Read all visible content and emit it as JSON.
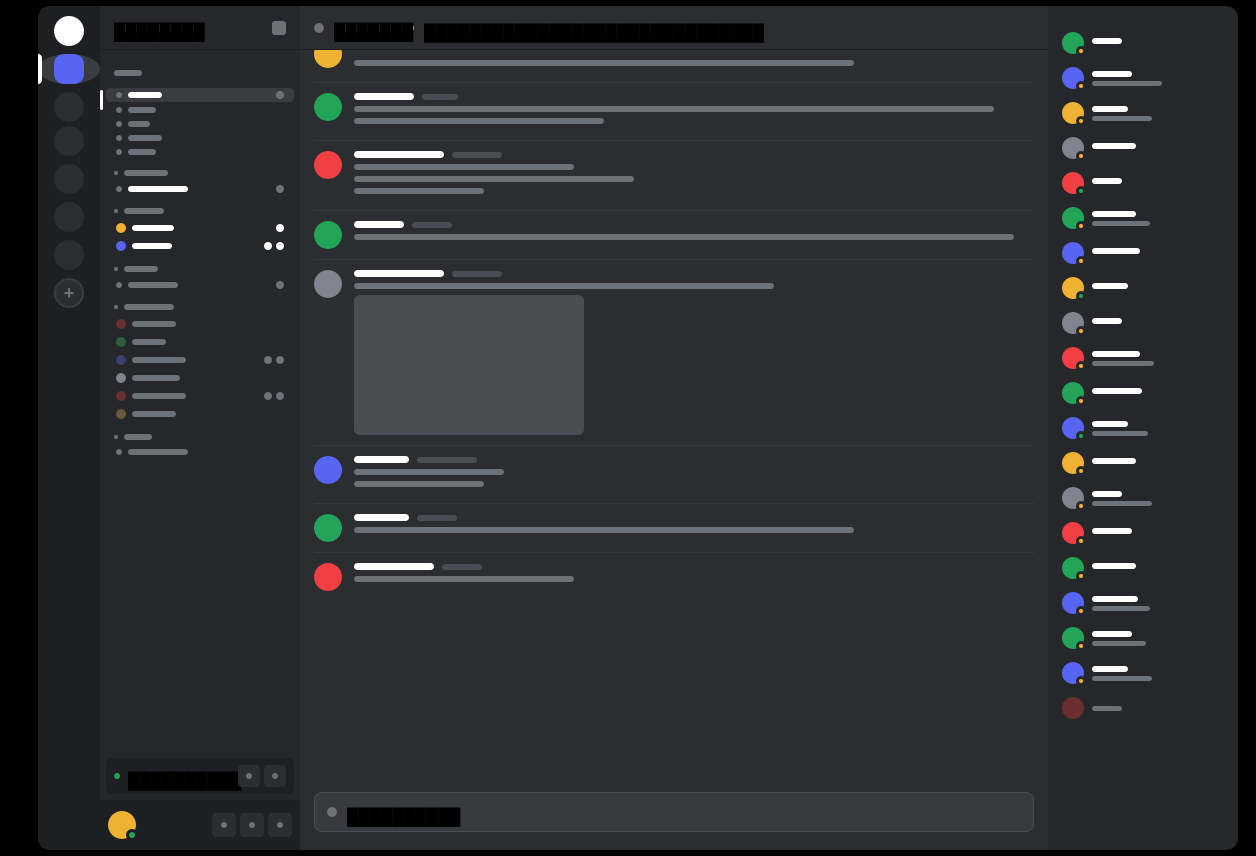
{
  "server_rail": {
    "home": {
      "color": "white"
    },
    "active_server": {
      "color": "blurple"
    },
    "cluster_count": 2,
    "extra_servers": 3,
    "add_label": "+"
  },
  "server_header": {
    "name": "████████",
    "dropdown_icon": "square"
  },
  "channel_categories": [
    {
      "label_w": 28,
      "items": []
    },
    {
      "label_w": 0,
      "items": [
        {
          "selected": true,
          "label_w": 34,
          "bright": true,
          "right_dot": "dim"
        },
        {
          "label_w": 28,
          "bright": false
        },
        {
          "label_w": 22,
          "bright": false
        },
        {
          "label_w": 34,
          "bright": false
        },
        {
          "label_w": 28,
          "bright": false
        }
      ]
    },
    {
      "label_w": 44,
      "dot": true,
      "items": [
        {
          "label_w": 60,
          "bright": true,
          "right_dot": "dim"
        }
      ]
    },
    {
      "label_w": 40,
      "dot": true,
      "items": [
        {
          "avatar": "yellow",
          "label_w": 42,
          "bright": true,
          "right": [
            "w"
          ]
        },
        {
          "avatar": "blurple",
          "label_w": 40,
          "bright": true,
          "right": [
            "w",
            "w"
          ]
        }
      ]
    },
    {
      "label_w": 34,
      "dot": true,
      "items": [
        {
          "label_w": 50,
          "bright": false,
          "right_dot": "dim"
        }
      ]
    },
    {
      "label_w": 50,
      "dot": true,
      "items": [
        {
          "avatar": "darkred",
          "label_w": 44,
          "bright": false
        },
        {
          "avatar": "darkgreen",
          "label_w": 34,
          "bright": false
        },
        {
          "avatar": "darkblue",
          "label_w": 54,
          "bright": false,
          "right": [
            "dim",
            "dim"
          ]
        },
        {
          "avatar": "gray",
          "label_w": 48,
          "bright": false
        },
        {
          "avatar": "darkred",
          "label_w": 54,
          "bright": false,
          "right": [
            "dim",
            "dim"
          ]
        },
        {
          "avatar": "darkbrown",
          "label_w": 44,
          "bright": false
        }
      ]
    },
    {
      "label_w": 28,
      "dot": true,
      "items": [
        {
          "label_w": 60,
          "bright": false
        }
      ]
    }
  ],
  "voice_panel": {
    "connected_label": "██████████"
  },
  "user_panel": {
    "avatar_color": "yellow",
    "status": "online"
  },
  "chat_header": {
    "icon": "hash",
    "title": "███████",
    "topic": "██████████████████████████████"
  },
  "messages": [
    {
      "avatar": "yellow",
      "half": true,
      "name_w": 0,
      "ts_w": 0,
      "lines": [
        500
      ]
    },
    {
      "avatar": "green",
      "name_w": 60,
      "ts_w": 36,
      "lines": [
        640,
        250
      ]
    },
    {
      "avatar": "red",
      "name_w": 90,
      "ts_w": 50,
      "lines": [
        220,
        280,
        130
      ]
    },
    {
      "avatar": "green",
      "name_w": 50,
      "ts_w": 40,
      "lines": [
        660
      ]
    },
    {
      "avatar": "gray",
      "name_w": 90,
      "ts_w": 50,
      "lines": [
        420
      ],
      "attachment": true
    },
    {
      "avatar": "blurple",
      "name_w": 55,
      "ts_w": 60,
      "lines": [
        150,
        130
      ]
    },
    {
      "avatar": "green",
      "name_w": 55,
      "ts_w": 40,
      "lines": [
        500
      ]
    },
    {
      "avatar": "red",
      "name_w": 80,
      "ts_w": 40,
      "lines": [
        220
      ]
    }
  ],
  "composer": {
    "placeholder": "██████████"
  },
  "members": [
    {
      "avatar": "green",
      "status": "idle",
      "name_w": 30,
      "sub_w": 0
    },
    {
      "avatar": "blurple",
      "status": "idle",
      "name_w": 40,
      "sub_w": 70
    },
    {
      "avatar": "yellow",
      "status": "idle",
      "name_w": 36,
      "sub_w": 60
    },
    {
      "avatar": "gray",
      "status": "idle",
      "name_w": 44,
      "sub_w": 0
    },
    {
      "avatar": "red",
      "status": "online",
      "name_w": 30,
      "sub_w": 0
    },
    {
      "avatar": "green",
      "status": "idle",
      "name_w": 44,
      "sub_w": 58
    },
    {
      "avatar": "blurple",
      "status": "idle",
      "name_w": 48,
      "sub_w": 0
    },
    {
      "avatar": "yellow",
      "status": "online",
      "name_w": 36,
      "sub_w": 0
    },
    {
      "avatar": "gray",
      "status": "idle",
      "name_w": 30,
      "sub_w": 0
    },
    {
      "avatar": "red",
      "status": "idle",
      "name_w": 48,
      "sub_w": 62
    },
    {
      "avatar": "green",
      "status": "idle",
      "name_w": 50,
      "sub_w": 0
    },
    {
      "avatar": "blurple",
      "status": "online",
      "name_w": 36,
      "sub_w": 56
    },
    {
      "avatar": "yellow",
      "status": "idle",
      "name_w": 44,
      "sub_w": 0
    },
    {
      "avatar": "gray",
      "status": "idle",
      "name_w": 30,
      "sub_w": 60
    },
    {
      "avatar": "red",
      "status": "idle",
      "name_w": 40,
      "sub_w": 0
    },
    {
      "avatar": "green",
      "status": "idle",
      "name_w": 44,
      "sub_w": 0
    },
    {
      "avatar": "blurple",
      "status": "idle",
      "name_w": 46,
      "sub_w": 58
    },
    {
      "avatar": "green",
      "status": "idle",
      "name_w": 40,
      "sub_w": 54
    },
    {
      "avatar": "blurple",
      "status": "idle",
      "name_w": 36,
      "sub_w": 60
    },
    {
      "avatar": "darkred",
      "status": null,
      "name_w": 0,
      "sub_w": 30
    }
  ]
}
